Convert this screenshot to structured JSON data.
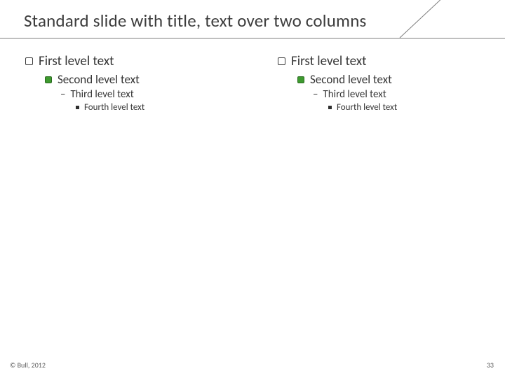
{
  "title": "Standard slide with title, text over two columns",
  "columns": {
    "left": {
      "l1": "First level text",
      "l2": "Second level text",
      "l3": "Third level text",
      "l4": "Fourth level text"
    },
    "right": {
      "l1": "First level text",
      "l2": "Second level text",
      "l3": "Third level text",
      "l4": "Fourth level text"
    }
  },
  "footer": {
    "copyright": "© Bull, 2012",
    "page": "33"
  },
  "bullets": {
    "dash": "–"
  },
  "colors": {
    "accent_green": "#3e9a2f",
    "rule_grey": "#7e7e7e"
  }
}
